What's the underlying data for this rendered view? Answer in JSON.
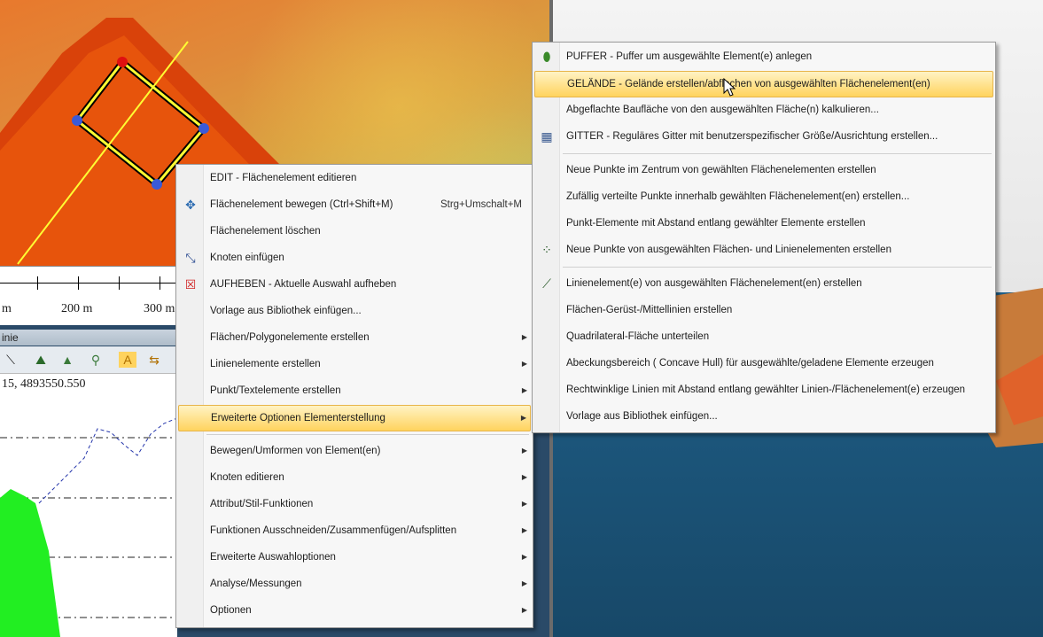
{
  "scale": {
    "labels": [
      "m",
      "200 m",
      "300 m"
    ]
  },
  "profile": {
    "title": "inie",
    "coordinate": "15, 4893550.550"
  },
  "context_menu": {
    "items": [
      {
        "label": "EDIT - Flächenelement editieren"
      },
      {
        "label": "Flächenelement bewegen (Ctrl+Shift+M)",
        "shortcut": "Strg+Umschalt+M"
      },
      {
        "label": "Flächenelement löschen"
      },
      {
        "label": "Knoten einfügen"
      },
      {
        "label": "AUFHEBEN - Aktuelle Auswahl aufheben"
      },
      {
        "label": "Vorlage aus Bibliothek einfügen..."
      },
      {
        "label": "Flächen/Polygonelemente erstellen"
      },
      {
        "label": "Linienelemente erstellen"
      },
      {
        "label": "Punkt/Textelemente erstellen"
      },
      {
        "label": "Erweiterte Optionen Elementerstellung"
      },
      {
        "label": "Bewegen/Umformen von Element(en)"
      },
      {
        "label": "Knoten editieren"
      },
      {
        "label": "Attribut/Stil-Funktionen"
      },
      {
        "label": "Funktionen Ausschneiden/Zusammenfügen/Aufsplitten"
      },
      {
        "label": "Erweiterte Auswahloptionen"
      },
      {
        "label": "Analyse/Messungen"
      },
      {
        "label": "Optionen"
      }
    ]
  },
  "submenu": {
    "items": [
      {
        "label": "PUFFER - Puffer um ausgewählte Element(e) anlegen"
      },
      {
        "label": "GELÄNDE - Gelände erstellen/abflachen von ausgewählten Flächenelement(en)"
      },
      {
        "label": "Abgeflachte Baufläche von den ausgewählten Fläche(n) kalkulieren..."
      },
      {
        "label": "GITTER - Reguläres Gitter mit benutzerspezifischer Größe/Ausrichtung erstellen..."
      },
      {
        "label": "Neue Punkte im Zentrum von gewählten Flächenelementen erstellen"
      },
      {
        "label": "Zufällig verteilte Punkte innerhalb gewählten Flächenelement(en) erstellen..."
      },
      {
        "label": "Punkt-Elemente mit Abstand entlang gewählter Elemente erstellen"
      },
      {
        "label": "Neue Punkte von ausgewählten Flächen- und Linienelementen erstellen"
      },
      {
        "label": "Linienelement(e) von ausgewählten Flächenelement(en) erstellen"
      },
      {
        "label": "Flächen-Gerüst-/Mittellinien erstellen"
      },
      {
        "label": "Quadrilateral-Fläche unterteilen"
      },
      {
        "label": "Abeckungsbereich ( Concave Hull) für ausgewählte/geladene Elemente erzeugen"
      },
      {
        "label": "Rechtwinklige Linien mit Abstand entlang gewählter Linien-/Flächenelement(e) erzeugen"
      },
      {
        "label": "Vorlage aus Bibliothek einfügen..."
      }
    ]
  }
}
